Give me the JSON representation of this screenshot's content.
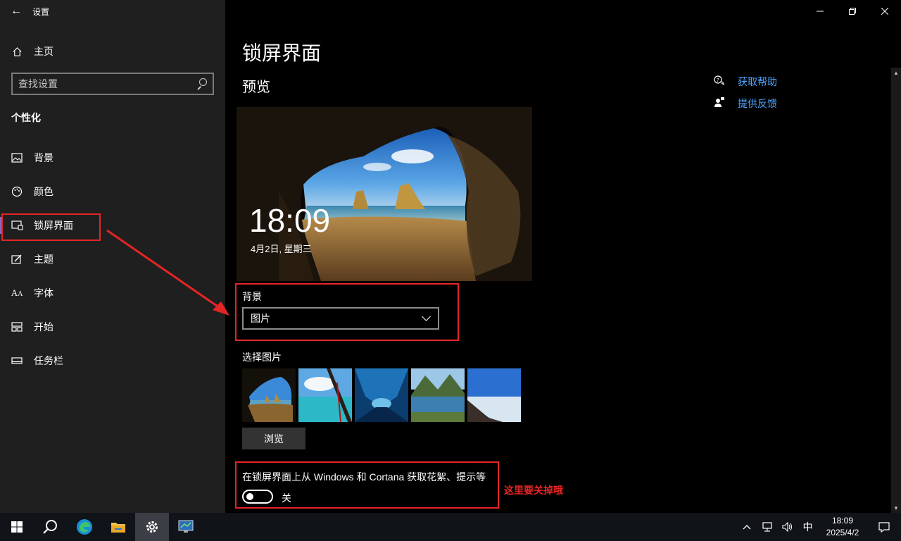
{
  "window": {
    "title": "设置"
  },
  "sidebar": {
    "home_label": "主页",
    "search_placeholder": "查找设置",
    "section": "个性化",
    "items": [
      {
        "label": "背景",
        "icon": "image-icon"
      },
      {
        "label": "颜色",
        "icon": "palette-icon"
      },
      {
        "label": "锁屏界面",
        "icon": "lockscreen-icon",
        "active": true
      },
      {
        "label": "主题",
        "icon": "theme-icon"
      },
      {
        "label": "字体",
        "icon": "font-icon"
      },
      {
        "label": "开始",
        "icon": "start-icon"
      },
      {
        "label": "任务栏",
        "icon": "taskbar-icon"
      }
    ]
  },
  "main": {
    "title": "锁屏界面",
    "preview_label": "预览",
    "preview_time": "18:09",
    "preview_date": "4月2日, 星期三",
    "background_label": "背景",
    "background_value": "图片",
    "choose_picture_label": "选择图片",
    "browse_label": "浏览",
    "tips_label": "在锁屏界面上从 Windows 和 Cortana 获取花絮、提示等",
    "tips_toggle_state": "关",
    "tips_toggle_on": false
  },
  "related": {
    "help": "获取帮助",
    "feedback": "提供反馈"
  },
  "annotation": {
    "note": "这里要关掉哦",
    "color": "#e52525"
  },
  "taskbar": {
    "apps": [
      "start-icon",
      "search-icon",
      "edge-icon",
      "file-explorer-icon",
      "settings-icon",
      "control-panel-icon"
    ],
    "ime": "中",
    "time": "18:09",
    "date": "2025/4/2"
  },
  "colors": {
    "accent_link": "#4ea4ff",
    "active_indicator": "#8a6cc7"
  }
}
